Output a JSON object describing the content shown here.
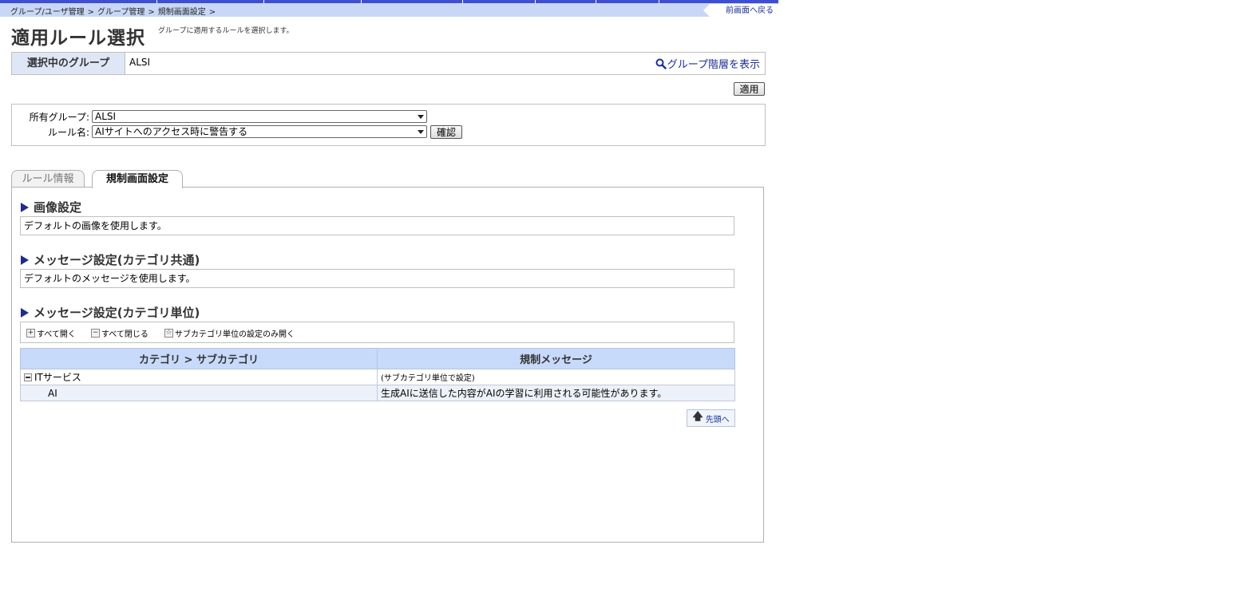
{
  "breadcrumb": [
    "グループ/ユーザ管理",
    "グループ管理",
    "規制画面設定"
  ],
  "breadcrumb_sep": ">",
  "back_link": "前画面へ戻る",
  "page": {
    "title": "適用ルール選択",
    "description": "グループに適用するルールを選択します。"
  },
  "selected_group": {
    "label": "選択中のグループ",
    "value": "ALSI",
    "hierarchy_link": "グループ階層を表示"
  },
  "apply_button": "適用",
  "filter": {
    "owner_group_label": "所有グループ:",
    "owner_group_value": "ALSI",
    "rule_name_label": "ルール名:",
    "rule_name_value": "AIサイトへのアクセス時に警告する",
    "confirm_button": "確認"
  },
  "tabs": [
    {
      "label": "ルール情報",
      "active": false
    },
    {
      "label": "規制画面設定",
      "active": true
    }
  ],
  "sections": {
    "image": {
      "title": "画像設定",
      "content": "デフォルトの画像を使用します。"
    },
    "message_common": {
      "title": "メッセージ設定(カテゴリ共通)",
      "content": "デフォルトのメッセージを使用します。"
    },
    "message_category": {
      "title": "メッセージ設定(カテゴリ単位)"
    }
  },
  "toolbar": {
    "expand_all": "すべて開く",
    "collapse_all": "すべて閉じる",
    "expand_sub_only": "サブカテゴリ単位の設定のみ開く"
  },
  "table": {
    "headers": [
      "カテゴリ > サブカテゴリ",
      "規制メッセージ"
    ],
    "rows": [
      {
        "category": "ITサービス",
        "message": "(サブカテゴリ単位で設定)"
      },
      {
        "category": "AI",
        "message": "生成AIに送信した内容がAIの学習に利用される可能性があります。"
      }
    ]
  },
  "to_top_button": "先頭へ",
  "colors": {
    "topbar_accent": "#3e4fd0",
    "topbar_bg": "#c9d7f7",
    "header_bg": "#c8dafa",
    "link": "#1a2f9c"
  }
}
